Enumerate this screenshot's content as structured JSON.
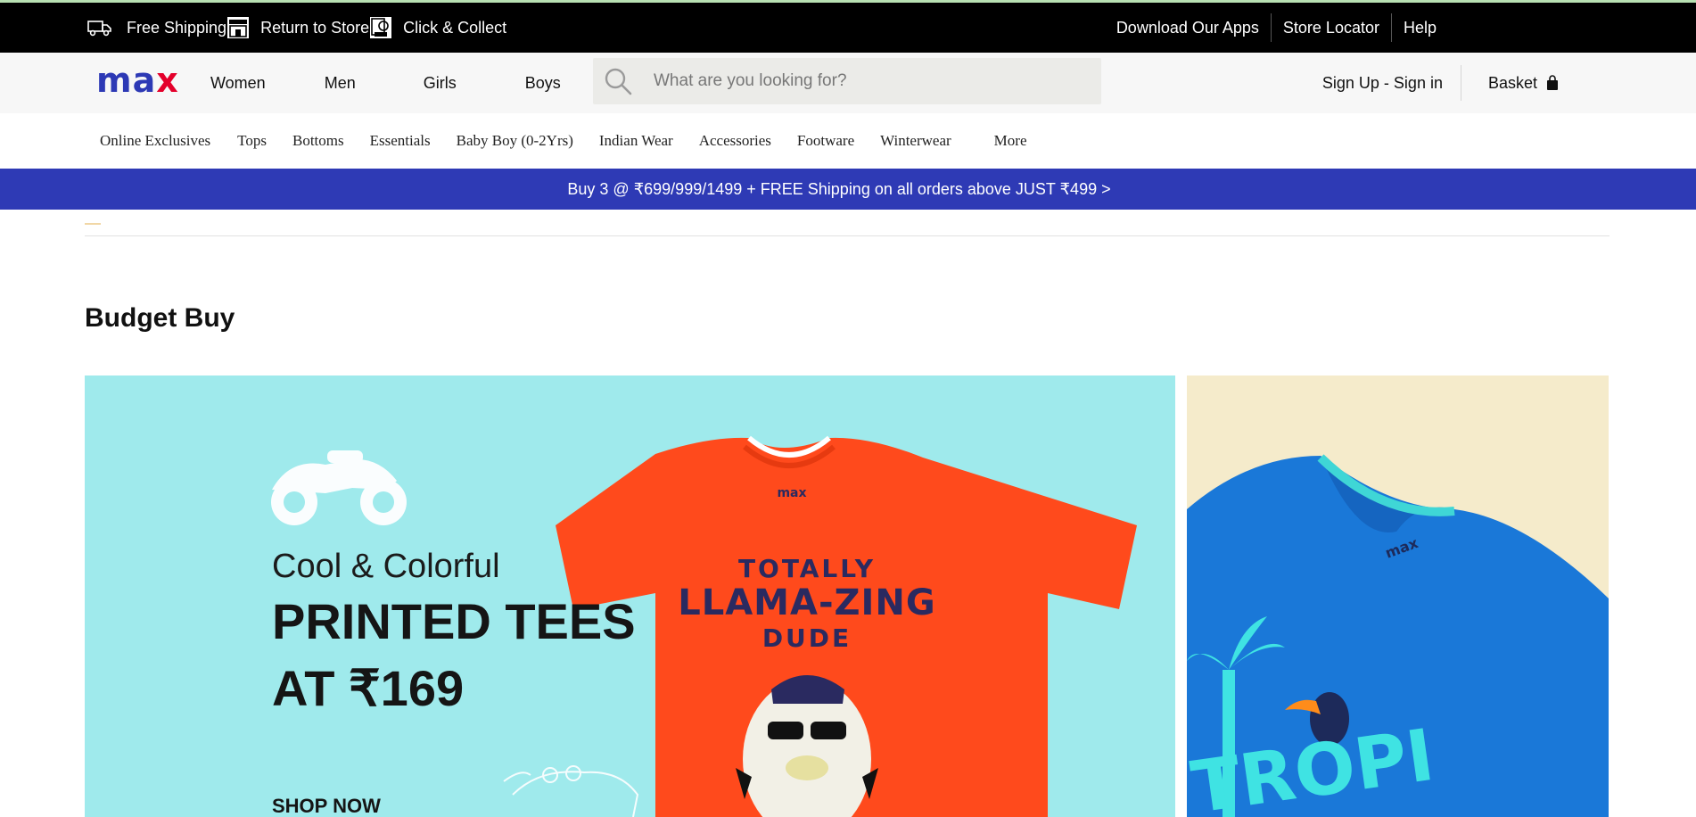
{
  "topbar": {
    "left_items": [
      {
        "label": "Free Shipping",
        "icon": "truck-icon"
      },
      {
        "label": "Return to Store",
        "icon": "store-icon"
      },
      {
        "label": "Click & Collect",
        "icon": "click-collect-icon"
      }
    ],
    "right_links": [
      "Download Our Apps",
      "Store Locator",
      "Help"
    ]
  },
  "header": {
    "logo": {
      "part1": "ma",
      "part2": "x"
    },
    "nav": [
      "Women",
      "Men",
      "Girls",
      "Boys"
    ],
    "search_placeholder": "What are you looking for?",
    "signin": "Sign Up - Sign in",
    "basket": "Basket"
  },
  "categories": [
    "Online Exclusives",
    "Tops",
    "Bottoms",
    "Essentials",
    "Baby Boy (0-2Yrs)",
    "Indian Wear",
    "Accessories",
    "Footware",
    "Winterwear",
    "More"
  ],
  "promo": "Buy 3 @ ₹699/999/1499 + FREE Shipping on all orders above JUST ₹499 >",
  "section_title": "Budget Buy",
  "banner": {
    "line1": "Cool & Colorful",
    "line2": "PRINTED TEES",
    "line3": "AT ₹169",
    "cta": "SHOP NOW",
    "tee_brand": "max",
    "tee_line1": "TOTALLY",
    "tee_line2": "LLAMA-ZING",
    "tee_line3": "DUDE",
    "side_tee_brand": "max"
  },
  "colors": {
    "brand_blue": "#2e3ab5",
    "brand_red": "#e4002b",
    "banner_bg": "#9feaec",
    "side_banner_bg": "#f5ebcb",
    "tee_orange": "#ff4a1c",
    "tee_blue": "#1a78d8"
  }
}
